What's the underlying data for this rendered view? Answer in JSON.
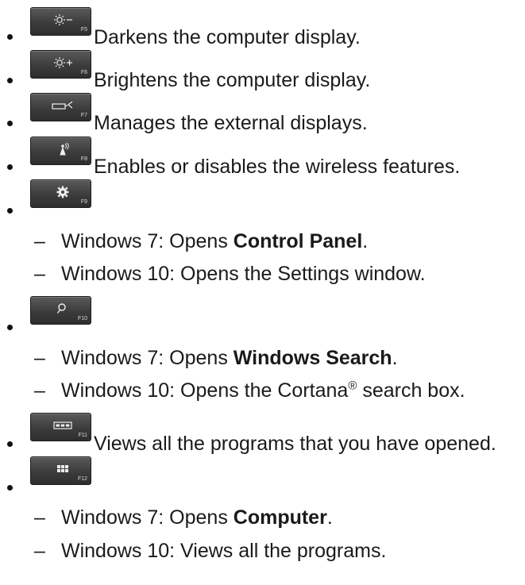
{
  "items": [
    {
      "fkey": "F5",
      "icon": "brightness-down-icon",
      "text": "Darkens the computer display."
    },
    {
      "fkey": "F6",
      "icon": "brightness-up-icon",
      "text": "Brightens the computer display."
    },
    {
      "fkey": "F7",
      "icon": "external-display-icon",
      "text": "Manages the external displays."
    },
    {
      "fkey": "F8",
      "icon": "wireless-icon",
      "text": "Enables or disables the wireless features."
    },
    {
      "fkey": "F9",
      "icon": "settings-gear-icon",
      "sub": [
        {
          "prefix": "Windows 7: Opens ",
          "bold": "Control Panel",
          "suffix": "."
        },
        {
          "prefix": "Windows 10: Opens the Settings window.",
          "bold": "",
          "suffix": ""
        }
      ]
    },
    {
      "fkey": "F10",
      "icon": "search-icon",
      "sub": [
        {
          "prefix": "Windows 7: Opens ",
          "bold": "Windows Search",
          "suffix": "."
        },
        {
          "prefix": "Windows 10: Opens the Cortana",
          "sup": "®",
          "suffix": " search box."
        }
      ]
    },
    {
      "fkey": "F11",
      "icon": "task-view-icon",
      "text": "Views all the programs that you have opened."
    },
    {
      "fkey": "F12",
      "icon": "apps-grid-icon",
      "sub": [
        {
          "prefix": "Windows 7: Opens ",
          "bold": "Computer",
          "suffix": "."
        },
        {
          "prefix": "Windows 10: Views all the programs.",
          "bold": "",
          "suffix": ""
        }
      ]
    }
  ]
}
